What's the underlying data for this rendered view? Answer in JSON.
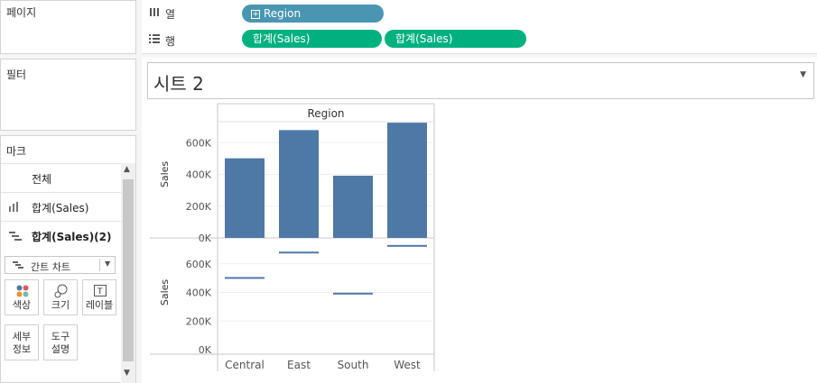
{
  "left_panel": {
    "pages_title": "페이지",
    "filters_title": "필터",
    "marks_title": "마크",
    "marks_rows": [
      {
        "label": "전체",
        "icon": "none",
        "bold": false
      },
      {
        "label": "합계(Sales)",
        "icon": "bar-chart-icon",
        "bold": false
      },
      {
        "label": "합계(Sales)(2)",
        "icon": "gantt-icon",
        "bold": true
      }
    ],
    "mark_type": "간트 차트",
    "buttons": [
      {
        "label": "색상",
        "icon": "color-icon"
      },
      {
        "label": "크기",
        "icon": "size-icon"
      },
      {
        "label": "레이블",
        "icon": "label-icon"
      },
      {
        "label": "세부\n정보",
        "icon": "detail-icon"
      },
      {
        "label": "도구\n설명",
        "icon": "tooltip-icon"
      }
    ]
  },
  "shelves": {
    "columns_label": "열",
    "rows_label": "행",
    "columns_pill": "Region",
    "rows_pills": [
      "합계(Sales)",
      "합계(Sales)"
    ]
  },
  "sheet": {
    "title": "시트 2"
  },
  "colors": {
    "bar": "#4e79a7",
    "pill_blue": "#4996b2",
    "pill_green": "#00b180"
  },
  "chart_data": [
    {
      "type": "bar",
      "header": "Region",
      "categories": [
        "Central",
        "East",
        "South",
        "West"
      ],
      "values": [
        501240,
        678781,
        391722,
        725458
      ],
      "ylabel": "Sales",
      "yticks": [
        "0K",
        "200K",
        "400K",
        "600K"
      ],
      "ylim": [
        0,
        800000
      ]
    },
    {
      "type": "gantt",
      "categories": [
        "Central",
        "East",
        "South",
        "West"
      ],
      "values": [
        501240,
        678781,
        391722,
        725458
      ],
      "ylabel": "Sales",
      "yticks": [
        "0K",
        "200K",
        "400K",
        "600K"
      ],
      "ylim": [
        0,
        800000
      ]
    }
  ]
}
